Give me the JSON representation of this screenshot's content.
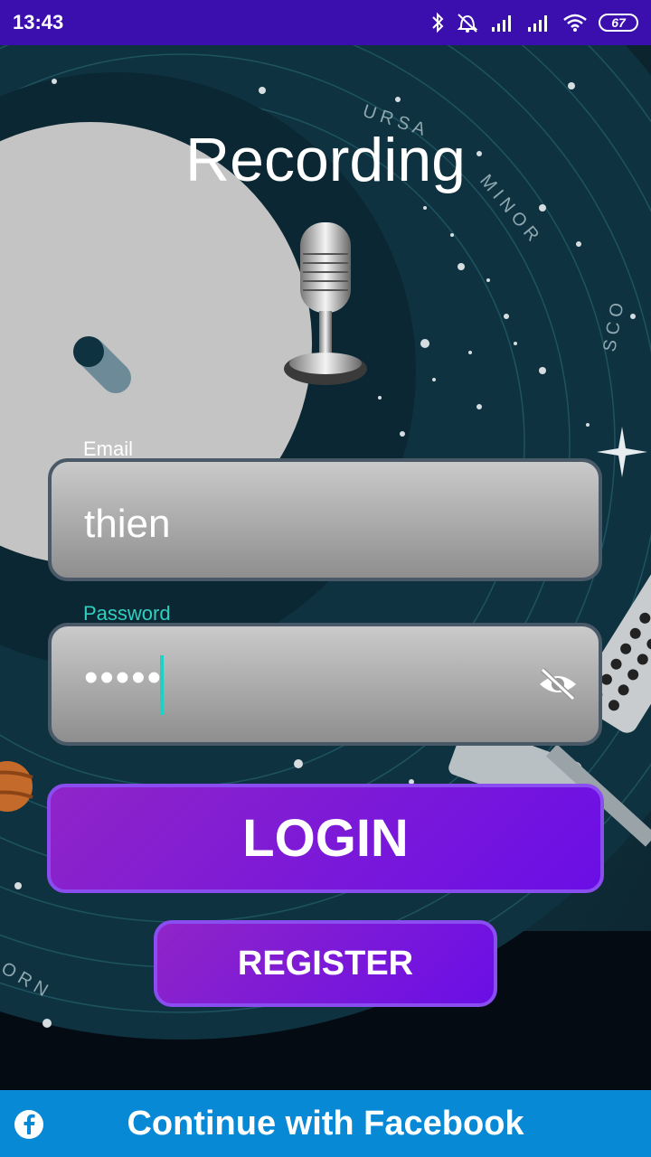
{
  "status": {
    "time": "13:43",
    "battery": "67",
    "icons": [
      "bluetooth-icon",
      "alarm-off-icon",
      "signal-icon",
      "signal-icon",
      "wifi-icon",
      "battery-icon"
    ]
  },
  "app": {
    "title": "Recording"
  },
  "form": {
    "email_label": "Email",
    "email_value": "thien",
    "password_label": "Password",
    "password_value": "•••••",
    "password_label_color": "#2fd0c0"
  },
  "buttons": {
    "login": "LOGIN",
    "register": "REGISTER",
    "facebook": "Continue with Facebook"
  },
  "colors": {
    "status_bar": "#3b0fae",
    "button_gradient_start": "#8f25c8",
    "button_gradient_end": "#6a0ee6",
    "facebook_bar": "#0889d6",
    "cursor": "#1fd1c4"
  }
}
